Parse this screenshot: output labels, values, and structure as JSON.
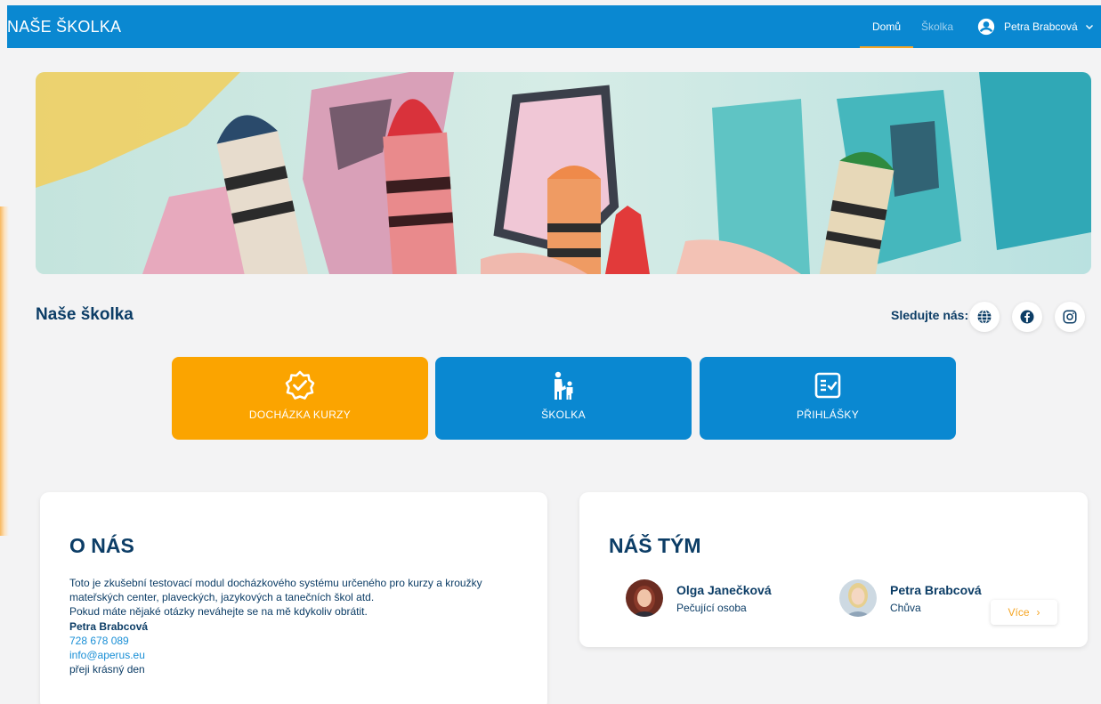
{
  "header": {
    "brand": "NAŠE ŠKOLKA",
    "nav": [
      {
        "label": "Domů",
        "active": true
      },
      {
        "label": "Školka",
        "active": false
      }
    ],
    "user_name": "Petra Brabcová",
    "bar_color": "#0a88d1",
    "active_underline_color": "#f5a524"
  },
  "page": {
    "title": "Naše školka",
    "follow_label": "Sledujte nás:",
    "social_icons": [
      "globe-icon",
      "facebook-icon",
      "instagram-icon"
    ]
  },
  "tiles": [
    {
      "label": "DOCHÁZKA KURZY",
      "icon": "badge-check-icon",
      "color": "#fba400"
    },
    {
      "label": "ŠKOLKA",
      "icon": "parent-child-icon",
      "color": "#0a88d1"
    },
    {
      "label": "PŘIHLÁŠKY",
      "icon": "checklist-icon",
      "color": "#0a88d1"
    }
  ],
  "about": {
    "title": "O NÁS",
    "lines": [
      "Toto je zkušební testovací modul docházkového systému určeného pro kurzy a kroužky",
      "mateřských center, plaveckých, jazykových a tanečních škol atd.",
      "Pokud máte nějaké otázky neváhejte se na mě kdykoliv obrátit."
    ],
    "contact_name": "Petra Brabcová",
    "phone": "728 678 089",
    "email": "info@aperus.eu",
    "closing": "přeji krásný den"
  },
  "team": {
    "title": "NÁŠ TÝM",
    "members": [
      {
        "name": "Olga Janečková",
        "role": "Pečující osoba"
      },
      {
        "name": "Petra Brabcová",
        "role": "Chůva"
      }
    ],
    "more_label": "Více",
    "more_arrow": "›"
  }
}
